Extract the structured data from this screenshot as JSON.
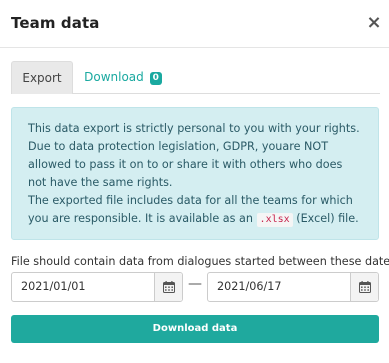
{
  "dialog": {
    "title": "Team data",
    "close_label": "×"
  },
  "tabs": [
    {
      "label": "Export",
      "active": true
    },
    {
      "label": "Download",
      "badge": "0",
      "active": false
    }
  ],
  "info": {
    "paragraph1": "This data export is strictly personal to you with your rights. Due to data protection legislation, GDPR, youare NOT allowed to pass it on to or share it with others who does not have the same rights.",
    "paragraph2_before": "The exported file includes data for all the teams for which you are responsible. It is available as an ",
    "paragraph2_code": ".xlsx",
    "paragraph2_after": " (Excel) file."
  },
  "date_range": {
    "label": "File should contain data from dialogues started between these dates",
    "from": "2021/01/01",
    "separator": "—",
    "to": "2021/06/17"
  },
  "actions": {
    "download_label": "Download data"
  },
  "colors": {
    "accent": "#1fa99e",
    "info_bg": "#d4eef1",
    "info_text": "#2a5a66",
    "code_text": "#c7254e"
  }
}
